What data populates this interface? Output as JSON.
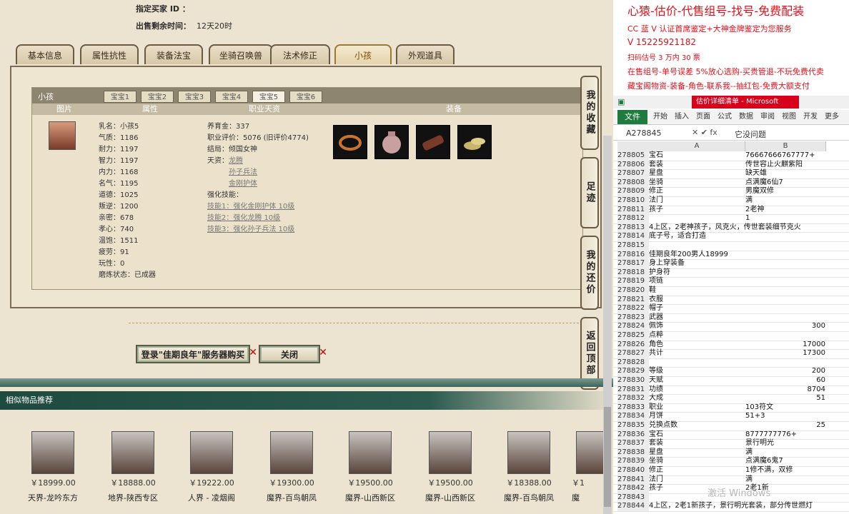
{
  "game": {
    "buyer_id_label": "指定买家 ID ：",
    "remaining_label": "出售剩余时间：",
    "remaining_value": "12天20时",
    "tabs": [
      "基本信息",
      "属性抗性",
      "装备法宝",
      "坐骑召唤兽",
      "法术修正",
      "小孩",
      "外观道具"
    ],
    "active_tab": "小孩",
    "section_title": "小孩",
    "baby_tabs": [
      "宝宝1",
      "宝宝2",
      "宝宝3",
      "宝宝4",
      "宝宝5",
      "宝宝6"
    ],
    "col_heads": [
      "图片",
      "属性",
      "职业天资",
      "装备"
    ],
    "attributes": [
      "乳名：小孩5",
      "气质：1186",
      "耐力：1197",
      "智力：1197",
      "内力：1168",
      "名气：1195",
      "道德：1025",
      "叛逆：1200",
      "亲密：678",
      "孝心：740",
      "温饱：1511",
      "疲劳：91",
      "玩性：0",
      "磨炼状态：已成器"
    ],
    "career": {
      "upbringing": "养育金：337",
      "rating": "职业评价：5076 (旧评价4774)",
      "ending": "结局：倾国女神",
      "talent_label": "天资：",
      "talents": [
        "龙腾",
        "孙子兵法",
        "金刚护体"
      ],
      "skills_label": "强化技能：",
      "skills": [
        "技能1：强化金刚护体 10级",
        "技能2：强化龙腾 10级",
        "技能3：强化孙子兵法 10级"
      ]
    },
    "side_buttons": [
      "我的收藏",
      "足迹",
      "我的还价",
      "返回顶部"
    ],
    "buy_button": "登录\"佳期良年\"服务器购买",
    "close_button": "关闭",
    "similar_title": "相似物品推荐",
    "recommendations": [
      {
        "price": "￥18999.00",
        "server": "天界-龙吟东方"
      },
      {
        "price": "￥18888.00",
        "server": "地界-陕西专区"
      },
      {
        "price": "￥19222.00",
        "server": "人界 - 凌烟阁"
      },
      {
        "price": "￥19300.00",
        "server": "魔界-百鸟朝凤"
      },
      {
        "price": "￥19500.00",
        "server": "魔界-山西新区"
      },
      {
        "price": "￥19500.00",
        "server": "魔界-山西新区"
      },
      {
        "price": "￥18388.00",
        "server": "魔界-百鸟朝凤"
      },
      {
        "price": "￥1",
        "server": "魔"
      }
    ]
  },
  "ads": [
    "心猿-估价-代售组号-找号-免费配装",
    "CC 蓝 V 认证首席鉴定+大神金牌鉴定为您服务",
    "V 15225921182",
    "扫码估号 3 万内 30 票",
    "在售组号-单号误差 5%放心选购-买贵管退-不玩免费代卖",
    "藏宝阁物资-装备-角色-联系我--抽红包-免费大额支付"
  ],
  "excel": {
    "window_title": "估价详细清单 - Microsoft Excel",
    "ribbon_tabs": [
      "文件",
      "开始",
      "插入",
      "页面",
      "公式",
      "数据",
      "审阅",
      "视图",
      "开发",
      "更多"
    ],
    "name_box": "A278845",
    "formula": "它没问题",
    "columns": [
      "A",
      "B"
    ],
    "rows": [
      {
        "n": "278805",
        "a": "宝石",
        "b": "76667666767777+"
      },
      {
        "n": "278806",
        "a": "套装",
        "b": "传世容止火麒紫阳"
      },
      {
        "n": "278807",
        "a": "星盘",
        "b": "缺天雄"
      },
      {
        "n": "278808",
        "a": "坐骑",
        "b": "点满魔6仙7"
      },
      {
        "n": "278809",
        "a": "修正",
        "b": "男魔双修"
      },
      {
        "n": "278810",
        "a": "法门",
        "b": "满"
      },
      {
        "n": "278811",
        "a": "孩子",
        "b": "2老神"
      },
      {
        "n": "278812",
        "a": "",
        "b": "1"
      },
      {
        "n": "278813",
        "a": "4上区，2老神孩子，风克火，传世套装细节克火",
        "b": ""
      },
      {
        "n": "278814",
        "a": "底子号，适合打造",
        "b": ""
      },
      {
        "n": "278815",
        "a": "",
        "b": ""
      },
      {
        "n": "278816",
        "a": "佳期良年200男人18999",
        "b": ""
      },
      {
        "n": "278817",
        "a": "身上穿装备",
        "b": ""
      },
      {
        "n": "278818",
        "a": "护身符",
        "b": ""
      },
      {
        "n": "278819",
        "a": "项链",
        "b": ""
      },
      {
        "n": "278820",
        "a": "鞋",
        "b": ""
      },
      {
        "n": "278821",
        "a": "衣服",
        "b": ""
      },
      {
        "n": "278822",
        "a": "帽子",
        "b": ""
      },
      {
        "n": "278823",
        "a": "武器",
        "b": ""
      },
      {
        "n": "278824",
        "a": "佩饰",
        "b": "300",
        "num": true
      },
      {
        "n": "278825",
        "a": "点粹",
        "b": ""
      },
      {
        "n": "278826",
        "a": "角色",
        "b": "17000",
        "num": true
      },
      {
        "n": "278827",
        "a": "共计",
        "b": "17300",
        "num": true
      },
      {
        "n": "278828",
        "a": "",
        "b": ""
      },
      {
        "n": "278829",
        "a": "等级",
        "b": "200",
        "num": true
      },
      {
        "n": "278830",
        "a": "天赋",
        "b": "60",
        "num": true
      },
      {
        "n": "278831",
        "a": "功绩",
        "b": "8704",
        "num": true
      },
      {
        "n": "278832",
        "a": "大成",
        "b": "51",
        "num": true
      },
      {
        "n": "278833",
        "a": "职业",
        "b": "103符文"
      },
      {
        "n": "278834",
        "a": "月饼",
        "b": "51+3"
      },
      {
        "n": "278835",
        "a": "兑换点数",
        "b": "25",
        "num": true
      },
      {
        "n": "278836",
        "a": "宝石",
        "b": "8777777776+"
      },
      {
        "n": "278837",
        "a": "套装",
        "b": "景行明光"
      },
      {
        "n": "278838",
        "a": "星盘",
        "b": "满"
      },
      {
        "n": "278839",
        "a": "坐骑",
        "b": "点满魔6鬼7"
      },
      {
        "n": "278840",
        "a": "修正",
        "b": "1修不满，双修"
      },
      {
        "n": "278841",
        "a": "法门",
        "b": "满"
      },
      {
        "n": "278842",
        "a": "孩子",
        "b": "2老1新"
      },
      {
        "n": "278843",
        "a": "",
        "b": ""
      },
      {
        "n": "278844",
        "a": "4上区，2老1新孩子，景行明光套装，部分传世燃灯",
        "b": ""
      }
    ],
    "watermark": "激活 Windows"
  }
}
